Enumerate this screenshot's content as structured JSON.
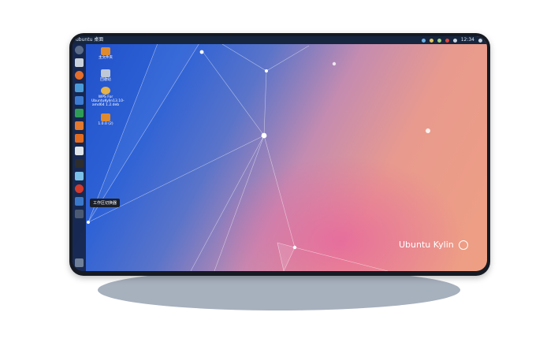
{
  "desktop": {
    "topbar": {
      "title": "ubuntu 桌面",
      "time": "12:34"
    },
    "desktop_icons": [
      {
        "label": "主文件夹",
        "icon": "folder-icon",
        "color": "#e08a2e"
      },
      {
        "label": "回收站",
        "icon": "trash-icon",
        "color": "#bfc8d6"
      },
      {
        "label": "WPS For UbuntuKylin13.10-amd64 1.2.deb",
        "icon": "package-icon",
        "color": "#e3b24a"
      },
      {
        "label": "1.0.0 (2)",
        "icon": "folder-icon",
        "color": "#e08a2e"
      }
    ],
    "tooltip": "工作区切换器",
    "brand": "Ubuntu Kylin"
  },
  "colors": {
    "bezel": "#161a22",
    "shadow": "#a7b0bd",
    "bg_blue": "#1f4ec8",
    "bg_peach": "#ef9f82",
    "bg_pink": "#e760a0"
  }
}
